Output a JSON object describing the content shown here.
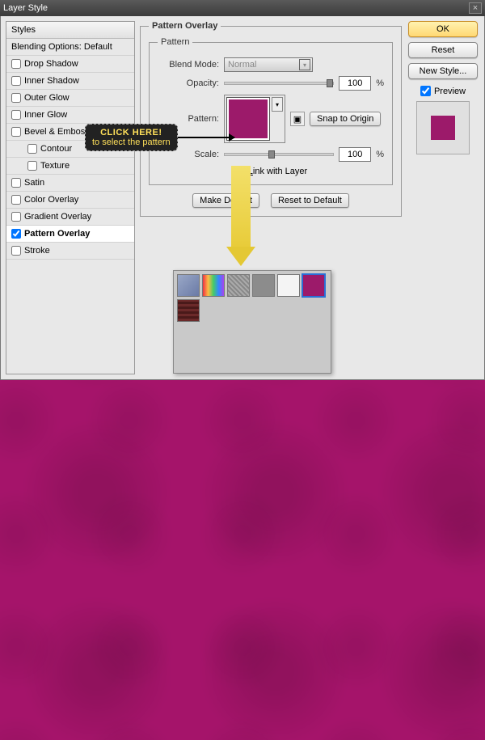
{
  "titlebar": {
    "title": "Layer Style",
    "close": "×"
  },
  "styles": {
    "header": "Styles",
    "blending": "Blending Options: Default",
    "items": [
      {
        "label": "Drop Shadow",
        "checked": false
      },
      {
        "label": "Inner Shadow",
        "checked": false
      },
      {
        "label": "Outer Glow",
        "checked": false
      },
      {
        "label": "Inner Glow",
        "checked": false
      },
      {
        "label": "Bevel & Emboss",
        "checked": false
      },
      {
        "label": "Contour",
        "checked": false,
        "indent": true
      },
      {
        "label": "Texture",
        "checked": false,
        "indent": true
      },
      {
        "label": "Satin",
        "checked": false
      },
      {
        "label": "Color Overlay",
        "checked": false
      },
      {
        "label": "Gradient Overlay",
        "checked": false
      },
      {
        "label": "Pattern Overlay",
        "checked": true,
        "active": true
      },
      {
        "label": "Stroke",
        "checked": false
      }
    ]
  },
  "panel": {
    "title": "Pattern Overlay",
    "inner_title": "Pattern",
    "blend_mode_label": "Blend Mode:",
    "blend_mode_value": "Normal",
    "opacity_label": "Opacity:",
    "opacity_value": "100",
    "pattern_label": "Pattern:",
    "snap_label": "Snap to Origin",
    "scale_label": "Scale:",
    "scale_value": "100",
    "percent": "%",
    "link_label": "Link with Layer",
    "link_checked": true,
    "make_default": "Make Default",
    "reset_default": "Reset to Default"
  },
  "buttons": {
    "ok": "OK",
    "reset": "Reset",
    "new_style": "New Style...",
    "preview": "Preview"
  },
  "callout": {
    "header": "CLICK HERE!",
    "sub": "to select the pattern"
  },
  "picker": {
    "thumbs": [
      {
        "bg": "linear-gradient(135deg,#9aa8c7,#6a7aa6)"
      },
      {
        "bg": "linear-gradient(90deg,#e34,#fb4,#4c6,#38f,#a4e)"
      },
      {
        "bg": "repeating-linear-gradient(45deg,#888,#888 2px,#aaa 2px,#aaa 4px)"
      },
      {
        "bg": "#8c8c8c"
      },
      {
        "bg": "#f4f4f4"
      },
      {
        "bg": "#9c1a6a",
        "selected": true
      },
      {
        "bg": "repeating-linear-gradient(0deg,#6b2a2a,#6b2a2a 3px,#4a1a1a 3px,#4a1a1a 6px)"
      }
    ]
  },
  "colors": {
    "magenta": "#9c1a6a"
  }
}
